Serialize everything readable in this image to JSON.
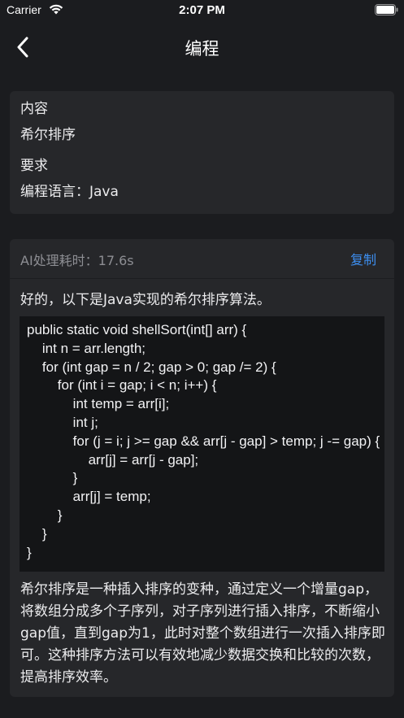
{
  "status_bar": {
    "carrier": "Carrier",
    "time": "2:07 PM"
  },
  "nav": {
    "title": "编程",
    "back_icon": "chevron-left-icon"
  },
  "request": {
    "content_label": "内容",
    "content_value": "希尔排序",
    "requirement_label": "要求",
    "requirement_value": "编程语言：Java"
  },
  "result": {
    "time_label": "AI处理耗时：17.6s",
    "copy_label": "复制",
    "intro": "好的，以下是Java实现的希尔排序算法。",
    "code": "public static void shellSort(int[] arr) {\n    int n = arr.length;\n    for (int gap = n / 2; gap > 0; gap /= 2) {\n        for (int i = gap; i < n; i++) {\n            int temp = arr[i];\n            int j;\n            for (j = i; j >= gap && arr[j - gap] > temp; j -= gap) {\n                arr[j] = arr[j - gap];\n            }\n            arr[j] = temp;\n        }\n    }\n}",
    "description": "希尔排序是一种插入排序的变种，通过定义一个增量gap，将数组分成多个子序列，对子序列进行插入排序，不断缩小gap值，直到gap为1，此时对整个数组进行一次插入排序即可。这种排序方法可以有效地减少数据交换和比较的次数，提高排序效率。"
  },
  "colors": {
    "background": "#1b1c1f",
    "card": "#26272a",
    "code_background": "#141517",
    "accent": "#3d8ff1",
    "muted_text": "#8d8e93"
  }
}
